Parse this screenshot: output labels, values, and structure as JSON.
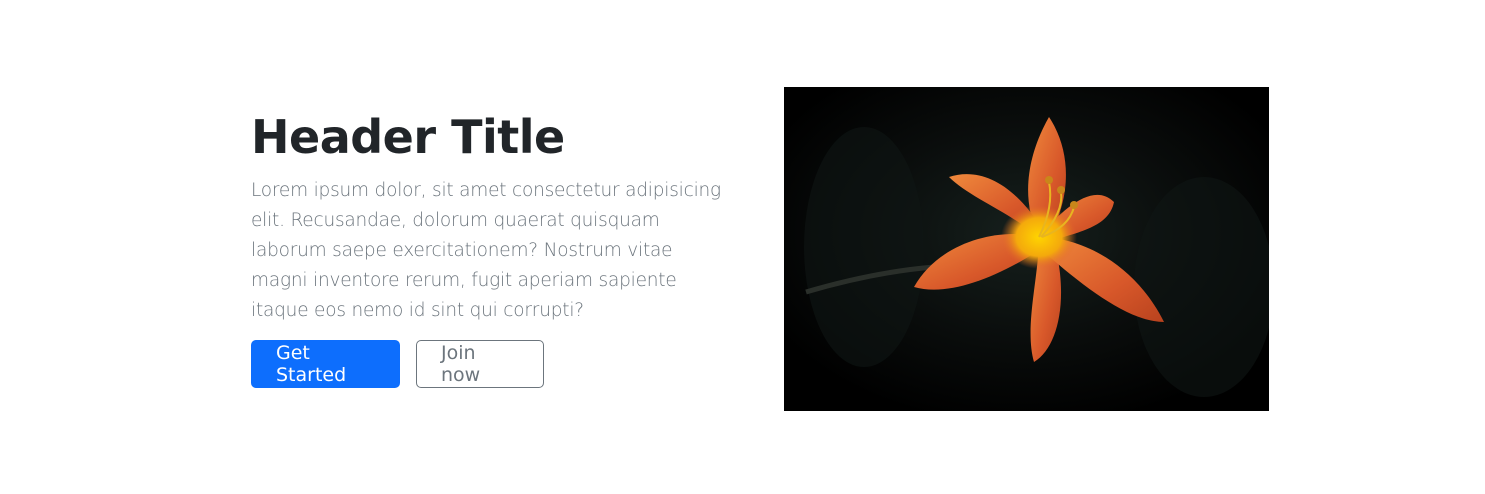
{
  "hero": {
    "title": "Header Title",
    "description": "Lorem ipsum dolor, sit amet consectetur adipisicing elit. Recusandae, dolorum quaerat quisquam laborum saepe exercitationem? Nostrum vitae magni inventore rerum, fugit aperiam sapiente itaque eos nemo id sint qui corrupti?",
    "primary_button": "Get Started",
    "secondary_button": "Join now",
    "image_subject": "orange lily flower on dark background"
  },
  "colors": {
    "title": "#212529",
    "text": "#6c757d",
    "primary": "#0d6efd",
    "outline": "#6c757d",
    "image_bg": "#000000",
    "petal": "#e0662a"
  }
}
